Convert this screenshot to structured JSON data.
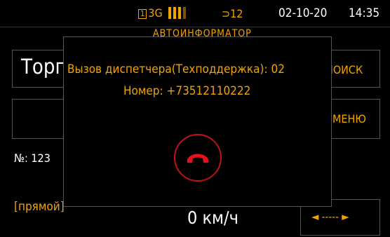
{
  "status": {
    "sim_slot": "1",
    "network": "3G",
    "power_value": "12",
    "date": "02-10-20",
    "time": "14:35",
    "signal_bar_colors": [
      "#f0a400",
      "#f0a400",
      "#f0a400",
      "#7a5400"
    ]
  },
  "background": {
    "title": "АВТОИНФОРМАТОР",
    "route_name": "Торг",
    "trip_number": "№: 123",
    "direction": "[прямой]",
    "speed": "0 км/ч",
    "search_label": "ПОИСК",
    "menu_label": "МЕНЮ",
    "arrows_label": "◄ ----- ►"
  },
  "dialog": {
    "call_title": "Вызов диспетчера(Техподдержка):  02",
    "phone_line": "Номер: +73512110222",
    "hangup_icon": "phone-hangup-icon",
    "hangup_color": "#c0101a"
  }
}
